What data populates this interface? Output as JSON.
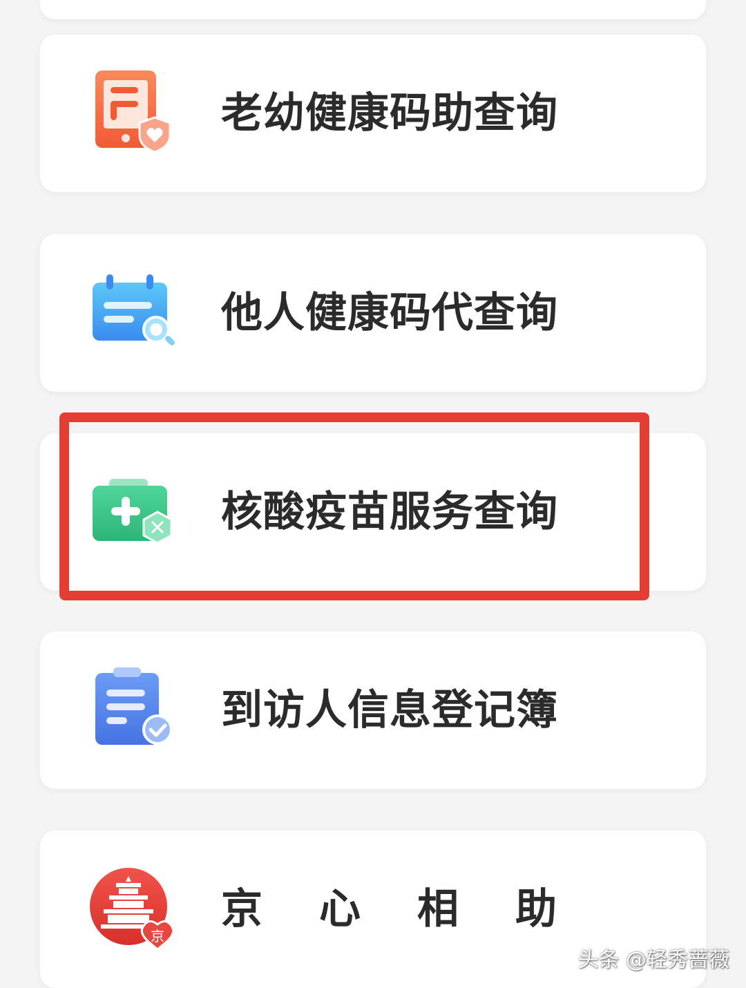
{
  "menu": {
    "items": [
      {
        "label": "老幼健康码助查询",
        "icon": "elderly-child-health-code-icon",
        "color": "#f4673f"
      },
      {
        "label": "他人健康码代查询",
        "icon": "calendar-search-icon",
        "color": "#3f9cf2"
      },
      {
        "label": "核酸疫苗服务查询",
        "icon": "medical-kit-dna-icon",
        "color": "#2fbf7f",
        "highlighted": true
      },
      {
        "label": "到访人信息登记簿",
        "icon": "clipboard-check-icon",
        "color": "#4f7ee8"
      },
      {
        "label": "京心相助",
        "icon": "jingxin-temple-icon",
        "color": "#e43d33"
      }
    ]
  },
  "highlight_color": "#e43d33",
  "watermark": "头条 @轻秀蔷薇"
}
